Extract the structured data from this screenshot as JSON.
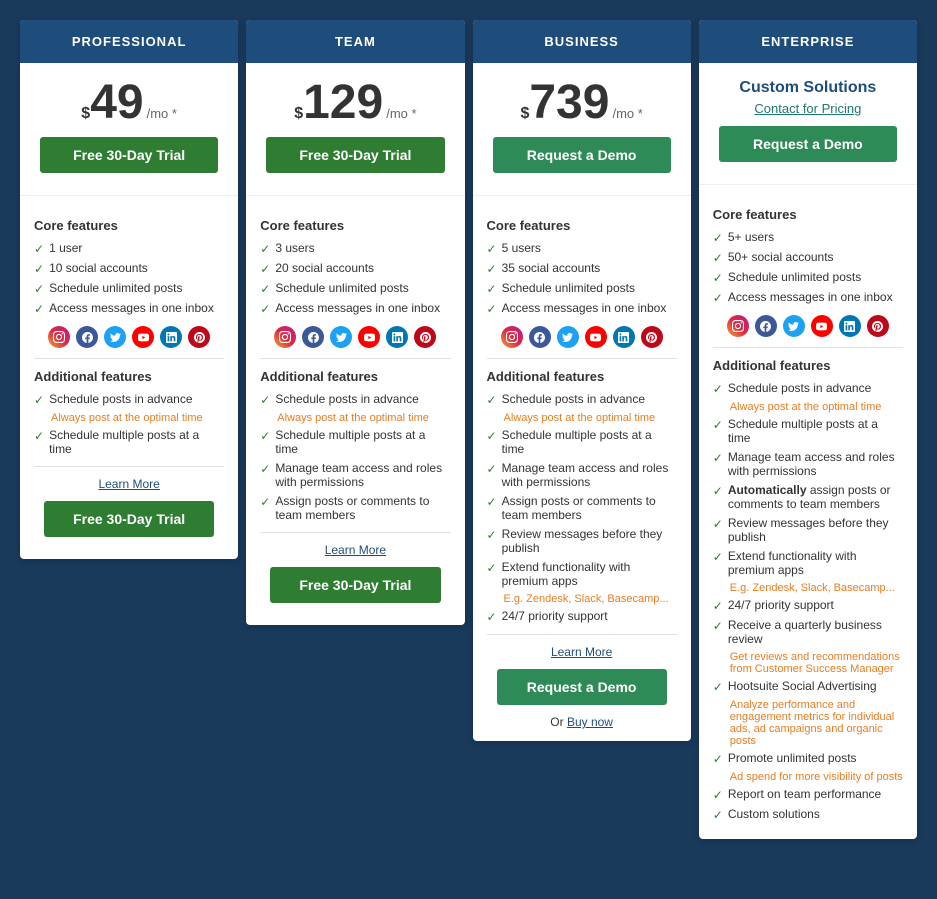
{
  "plans": [
    {
      "id": "professional",
      "header": "PROFESSIONAL",
      "price_symbol": "$",
      "price_amount": "49",
      "price_period": "/mo *",
      "cta_label": "Free 30-Day Trial",
      "cta_type": "trial",
      "bottom_cta_label": "Free 30-Day Trial",
      "bottom_cta_type": "trial",
      "learn_more": "Learn More",
      "core_features_title": "Core features",
      "core_features": [
        "1 user",
        "10 social accounts",
        "Schedule unlimited posts",
        "Access messages in one inbox"
      ],
      "additional_features_title": "Additional features",
      "additional_features": [
        {
          "text": "Schedule posts in advance",
          "sub": "Always post at the optimal time"
        },
        {
          "text": "Schedule multiple posts at a time",
          "sub": null
        }
      ],
      "show_buy_now": false
    },
    {
      "id": "team",
      "header": "TEAM",
      "price_symbol": "$",
      "price_amount": "129",
      "price_period": "/mo *",
      "cta_label": "Free 30-Day Trial",
      "cta_type": "trial",
      "bottom_cta_label": "Free 30-Day Trial",
      "bottom_cta_type": "trial",
      "learn_more": "Learn More",
      "core_features_title": "Core features",
      "core_features": [
        "3 users",
        "20 social accounts",
        "Schedule unlimited posts",
        "Access messages in one inbox"
      ],
      "additional_features_title": "Additional features",
      "additional_features": [
        {
          "text": "Schedule posts in advance",
          "sub": "Always post at the optimal time"
        },
        {
          "text": "Schedule multiple posts at a time",
          "sub": null
        },
        {
          "text": "Manage team access and roles with permissions",
          "sub": null
        },
        {
          "text": "Assign posts or comments to team members",
          "sub": null
        }
      ],
      "show_buy_now": false
    },
    {
      "id": "business",
      "header": "BUSINESS",
      "price_symbol": "$",
      "price_amount": "739",
      "price_period": "/mo *",
      "cta_label": "Request a Demo",
      "cta_type": "demo",
      "bottom_cta_label": "Request a Demo",
      "bottom_cta_type": "demo",
      "learn_more": "Learn More",
      "core_features_title": "Core features",
      "core_features": [
        "5 users",
        "35 social accounts",
        "Schedule unlimited posts",
        "Access messages in one inbox"
      ],
      "additional_features_title": "Additional features",
      "additional_features": [
        {
          "text": "Schedule posts in advance",
          "sub": "Always post at the optimal time"
        },
        {
          "text": "Schedule multiple posts at a time",
          "sub": null
        },
        {
          "text": "Manage team access and roles with permissions",
          "sub": null
        },
        {
          "text": "Assign posts or comments to team members",
          "sub": null
        },
        {
          "text": "Review messages before they publish",
          "sub": null
        },
        {
          "text": "Extend functionality with premium apps",
          "sub": "E.g. Zendesk, Slack, Basecamp..."
        },
        {
          "text": "24/7 priority support",
          "sub": null
        }
      ],
      "show_buy_now": true,
      "buy_now_label": "Or ",
      "buy_now_link_text": "Buy now"
    },
    {
      "id": "enterprise",
      "header": "ENTERPRISE",
      "is_custom": true,
      "custom_solutions_label": "Custom Solutions",
      "contact_pricing_label": "Contact for Pricing",
      "cta_label": "Request a Demo",
      "cta_type": "demo",
      "core_features_title": "Core features",
      "core_features": [
        "5+ users",
        "50+ social accounts",
        "Schedule unlimited posts",
        "Access messages in one inbox"
      ],
      "additional_features_title": "Additional features",
      "additional_features": [
        {
          "text": "Schedule posts in advance",
          "sub": "Always post at the optimal time"
        },
        {
          "text": "Schedule multiple posts at a time",
          "sub": null
        },
        {
          "text": "Manage team access and roles with permissions",
          "sub": null
        },
        {
          "text": "Automatically assign posts or comments to team members",
          "sub": null,
          "bold_word": "Automatically"
        },
        {
          "text": "Review messages before they publish",
          "sub": null
        },
        {
          "text": "Extend functionality with premium apps",
          "sub": "E.g. Zendesk, Slack, Basecamp..."
        },
        {
          "text": "24/7 priority support",
          "sub": null
        },
        {
          "text": "Receive a quarterly business review",
          "sub": "Get reviews and recommendations from Customer Success Manager",
          "sub_orange": true
        },
        {
          "text": "Hootsuite Social Advertising",
          "sub": "Analyze performance and engagement metrics for individual ads, ad campaigns and organic posts",
          "sub_orange": true
        },
        {
          "text": "Promote unlimited posts",
          "sub": "Ad spend for more visibility of posts",
          "sub_orange": true
        },
        {
          "text": "Report on team performance",
          "sub": null
        },
        {
          "text": "Custom solutions",
          "sub": null
        }
      ],
      "show_buy_now": false
    }
  ],
  "social_icons": [
    {
      "name": "instagram",
      "class": "si-instagram",
      "symbol": "📷"
    },
    {
      "name": "facebook",
      "class": "si-facebook",
      "symbol": "f"
    },
    {
      "name": "twitter",
      "class": "si-twitter",
      "symbol": "t"
    },
    {
      "name": "youtube",
      "class": "si-youtube",
      "symbol": "▶"
    },
    {
      "name": "linkedin",
      "class": "si-linkedin",
      "symbol": "in"
    },
    {
      "name": "pinterest",
      "class": "si-pinterest",
      "symbol": "P"
    }
  ]
}
